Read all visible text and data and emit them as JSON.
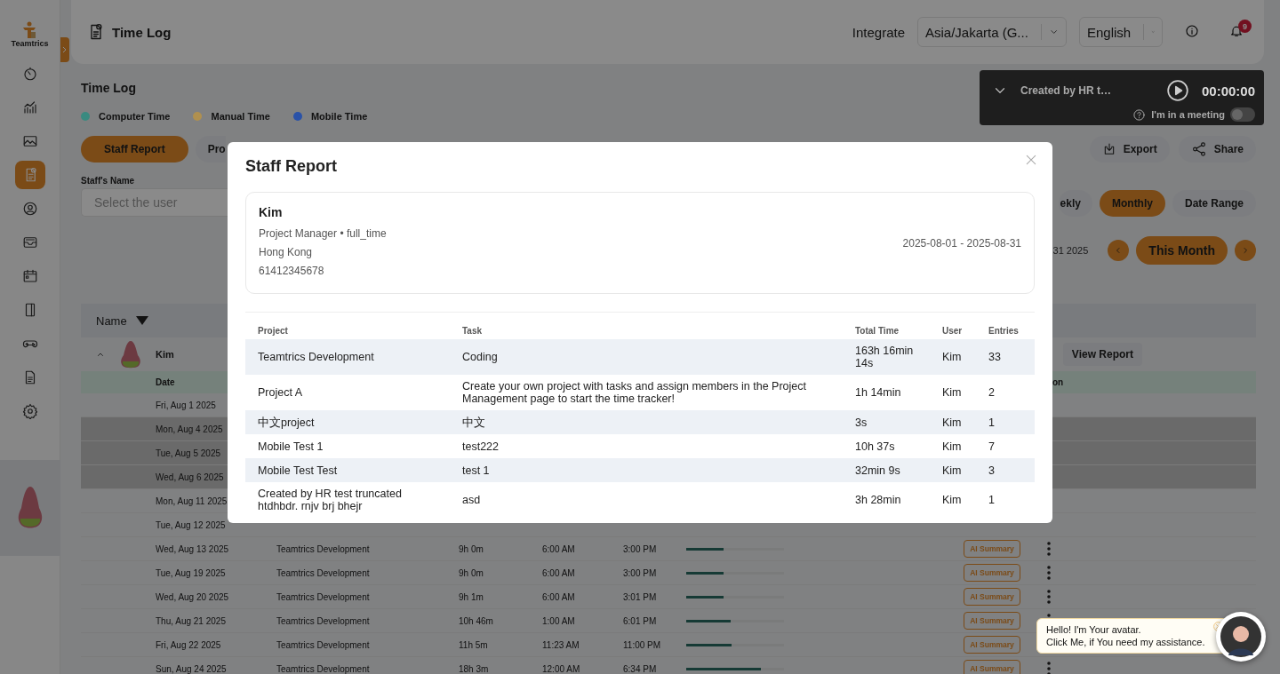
{
  "sidebar": {
    "logo": "Teamtrics",
    "items": [
      {
        "kind": "timer",
        "selected": false
      },
      {
        "kind": "chart",
        "selected": false
      },
      {
        "kind": "image",
        "selected": false
      },
      {
        "kind": "timelog",
        "selected": true
      },
      {
        "kind": "user",
        "selected": false
      },
      {
        "kind": "inbox",
        "selected": false
      },
      {
        "kind": "calendar",
        "selected": false
      },
      {
        "kind": "panel",
        "selected": false
      },
      {
        "kind": "gamepad",
        "selected": false
      },
      {
        "kind": "document",
        "selected": false
      },
      {
        "kind": "settings",
        "selected": false
      }
    ]
  },
  "header": {
    "title": "Time Log",
    "integrate": "Integrate",
    "timezone": "Asia/Jakarta (G...",
    "language": "English",
    "notifications": "9"
  },
  "page": {
    "title": "Time Log",
    "legend": [
      {
        "label": "Computer Time",
        "color": "#3a8a80"
      },
      {
        "label": "Manual Time",
        "color": "#b0904f"
      },
      {
        "label": "Mobile Time",
        "color": "#2a52a8"
      }
    ],
    "tabs": [
      {
        "label": "Staff Report",
        "selected": true
      },
      {
        "label": "Pro",
        "selected": false
      }
    ],
    "export": "Export",
    "share": "Share",
    "staff_label": "Staff's Name",
    "staff_placeholder": "Select the user",
    "periods": [
      {
        "label": "ekly",
        "selected": false
      },
      {
        "label": "Monthly",
        "selected": true
      },
      {
        "label": "Date Range",
        "selected": false
      }
    ],
    "range_text": "31 2025",
    "this_month": "This Month",
    "table": {
      "name_header": "Name",
      "group": {
        "name": "Kim",
        "expanded": true,
        "action": "View Report"
      },
      "date_header": "Date",
      "action_header": "on",
      "rows": [
        {
          "date": "Fri, Aug 1 2025",
          "highlighted": false
        },
        {
          "date": "Mon, Aug 4 2025",
          "highlighted": true
        },
        {
          "date": "Tue, Aug 5 2025",
          "highlighted": true
        },
        {
          "date": "Wed, Aug 6 2025",
          "highlighted": true
        },
        {
          "date": "Mon, Aug 11 2025",
          "highlighted": false
        },
        {
          "date": "Tue, Aug 12 2025",
          "highlighted": false
        },
        {
          "date": "Wed, Aug 13 2025",
          "highlighted": false,
          "project": "Teamtrics Development",
          "duration": "9h 0m",
          "start": "6:00 AM",
          "end": "3:00 PM",
          "level": 0.38,
          "summary": "AI Summary"
        },
        {
          "date": "Tue, Aug 19 2025",
          "highlighted": false,
          "project": "Teamtrics Development",
          "duration": "9h 0m",
          "start": "6:00 AM",
          "end": "3:00 PM",
          "level": 0.38,
          "summary": "AI Summary"
        },
        {
          "date": "Wed, Aug 20 2025",
          "highlighted": false,
          "project": "Teamtrics Development",
          "duration": "9h 1m",
          "start": "6:00 AM",
          "end": "3:01 PM",
          "level": 0.38,
          "summary": "AI Summary"
        },
        {
          "date": "Thu, Aug 21 2025",
          "highlighted": false,
          "project": "Teamtrics Development",
          "duration": "10h 46m",
          "start": "1:00 AM",
          "end": "6:01 PM",
          "level": 0.45,
          "summary": "AI Summary"
        },
        {
          "date": "Fri, Aug 22 2025",
          "highlighted": false,
          "project": "Teamtrics Development",
          "duration": "11h 5m",
          "start": "11:23 AM",
          "end": "11:00 PM",
          "level": 0.46,
          "summary": "AI Summary"
        },
        {
          "date": "Sun, Aug 24 2025",
          "highlighted": false,
          "project": "Teamtrics Development",
          "duration": "18h 3m",
          "start": "12:00 AM",
          "end": "6:34 PM",
          "level": 0.76,
          "summary": "AI Summary"
        }
      ]
    }
  },
  "timer": {
    "task": "Created by HR t…",
    "time": "00:00:00",
    "meeting_label": "I'm in a meeting",
    "meeting_on": false
  },
  "modal": {
    "title": "Staff Report",
    "person": {
      "name": "Kim",
      "role": "Project Manager • full_time",
      "location": "Hong Kong",
      "phone": "61412345678",
      "period": "2025-08-01 - 2025-08-31"
    },
    "columns": [
      "Project",
      "Task",
      "Total Time",
      "User",
      "Entries"
    ],
    "rows": [
      [
        "Teamtrics Development",
        "Coding",
        "163h 16min 14s",
        "Kim",
        "33"
      ],
      [
        "Project A",
        "Create your own project with tasks and assign members in the Project Management page to start the time tracker!",
        "1h 14min",
        "Kim",
        "2"
      ],
      [
        "中文project",
        "中文",
        "3s",
        "Kim",
        "1"
      ],
      [
        "Mobile Test 1",
        "test222",
        "10h 37s",
        "Kim",
        "7"
      ],
      [
        "Mobile Test Test",
        "test 1",
        "32min 9s",
        "Kim",
        "3"
      ],
      [
        "Created by HR test truncated htdhbdr. rnjv brj bhejr",
        "asd",
        "3h 28min",
        "Kim",
        "1"
      ]
    ]
  },
  "chat": {
    "lines": [
      "Hello! I'm Your avatar.",
      "Click Me, if You need my assistance."
    ]
  }
}
